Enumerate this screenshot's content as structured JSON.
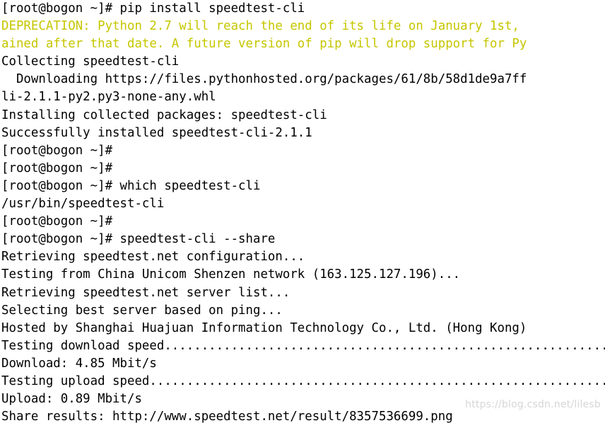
{
  "terminal": {
    "colors": {
      "background": "#ffffff",
      "foreground": "#000000",
      "warning": "#c6c600",
      "watermark": "#d6d6d6"
    },
    "watermark": "https://blog.csdn.net/lilesb",
    "lines": [
      {
        "text": "[root@bogon ~]# pip install speedtest-cli",
        "kind": "prompt"
      },
      {
        "text": "DEPRECATION: Python 2.7 will reach the end of its life on January 1st,",
        "kind": "warning"
      },
      {
        "text": "ained after that date. A future version of pip will drop support for Py",
        "kind": "warning"
      },
      {
        "text": "Collecting speedtest-cli",
        "kind": "output"
      },
      {
        "text": "  Downloading https://files.pythonhosted.org/packages/61/8b/58d1de9a7ff",
        "kind": "output"
      },
      {
        "text": "li-2.1.1-py2.py3-none-any.whl",
        "kind": "output"
      },
      {
        "text": "Installing collected packages: speedtest-cli",
        "kind": "output"
      },
      {
        "text": "Successfully installed speedtest-cli-2.1.1",
        "kind": "output"
      },
      {
        "text": "[root@bogon ~]#",
        "kind": "prompt"
      },
      {
        "text": "[root@bogon ~]#",
        "kind": "prompt"
      },
      {
        "text": "[root@bogon ~]# which speedtest-cli",
        "kind": "prompt"
      },
      {
        "text": "/usr/bin/speedtest-cli",
        "kind": "output"
      },
      {
        "text": "[root@bogon ~]#",
        "kind": "prompt"
      },
      {
        "text": "[root@bogon ~]# speedtest-cli --share",
        "kind": "prompt"
      },
      {
        "text": "Retrieving speedtest.net configuration...",
        "kind": "output"
      },
      {
        "text": "Testing from China Unicom Shenzen network (163.125.127.196)...",
        "kind": "output"
      },
      {
        "text": "Retrieving speedtest.net server list...",
        "kind": "output"
      },
      {
        "text": "Selecting best server based on ping...",
        "kind": "output"
      },
      {
        "text": "Hosted by Shanghai Huajuan Information Technology Co., Ltd. (Hong Kong)",
        "kind": "output"
      },
      {
        "text": "Testing download speed................................................................................",
        "kind": "output"
      },
      {
        "text": "Download: 4.85 Mbit/s",
        "kind": "output"
      },
      {
        "text": "Testing upload speed................................................................................",
        "kind": "output"
      },
      {
        "text": "Upload: 0.89 Mbit/s",
        "kind": "output"
      },
      {
        "text": "Share results: http://www.speedtest.net/result/8357536699.png",
        "kind": "output"
      }
    ]
  }
}
